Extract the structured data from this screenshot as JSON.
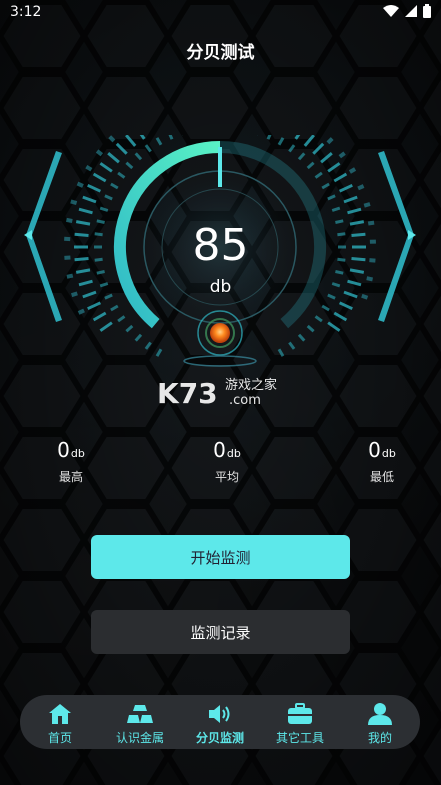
{
  "status": {
    "time": "3:12"
  },
  "page": {
    "title": "分贝测试"
  },
  "gauge": {
    "value": "85",
    "unit": "db",
    "level_percent": 85
  },
  "stats": [
    {
      "value": "0",
      "unit": "db",
      "label": "最高"
    },
    {
      "value": "0",
      "unit": "db",
      "label": "平均"
    },
    {
      "value": "0",
      "unit": "db",
      "label": "最低"
    }
  ],
  "buttons": {
    "start": "开始监测",
    "record": "监测记录"
  },
  "tabs": [
    {
      "label": "首页",
      "icon": "home-icon"
    },
    {
      "label": "认识金属",
      "icon": "gold-bars-icon"
    },
    {
      "label": "分贝监测",
      "icon": "speaker-icon",
      "active": true
    },
    {
      "label": "其它工具",
      "icon": "toolbox-icon"
    },
    {
      "label": "我的",
      "icon": "user-icon"
    }
  ],
  "watermark": {
    "brand": "K73",
    "text": "游戏之家",
    "domain": ".com"
  },
  "colors": {
    "accent": "#5de8ea",
    "orb": "#ff7a1a",
    "tabbar": "#2c2f33"
  }
}
